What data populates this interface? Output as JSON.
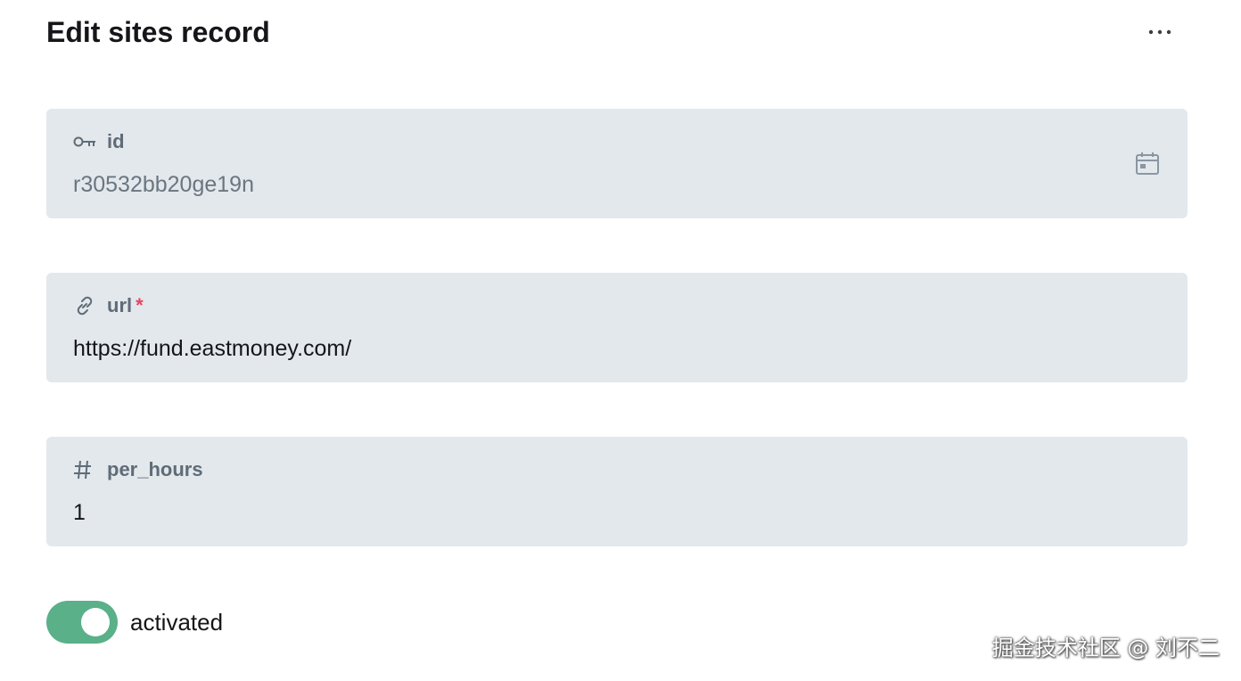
{
  "header": {
    "title_prefix": "Edit",
    "collection": "sites",
    "title_suffix": "record",
    "menu_icon": "more-horizontal-icon"
  },
  "fields": {
    "id": {
      "label": "id",
      "icon": "key-icon",
      "value": "r30532bb20ge19n",
      "side_icon": "calendar-icon"
    },
    "url": {
      "label": "url",
      "icon": "link-icon",
      "required_marker": "*",
      "value": "https://fund.eastmoney.com/"
    },
    "per_hours": {
      "label": "per_hours",
      "icon": "hash-icon",
      "value": "1"
    }
  },
  "toggle": {
    "label": "activated",
    "checked": true,
    "color": "#5ab089"
  },
  "watermark": "掘金技术社区 @ 刘不二"
}
